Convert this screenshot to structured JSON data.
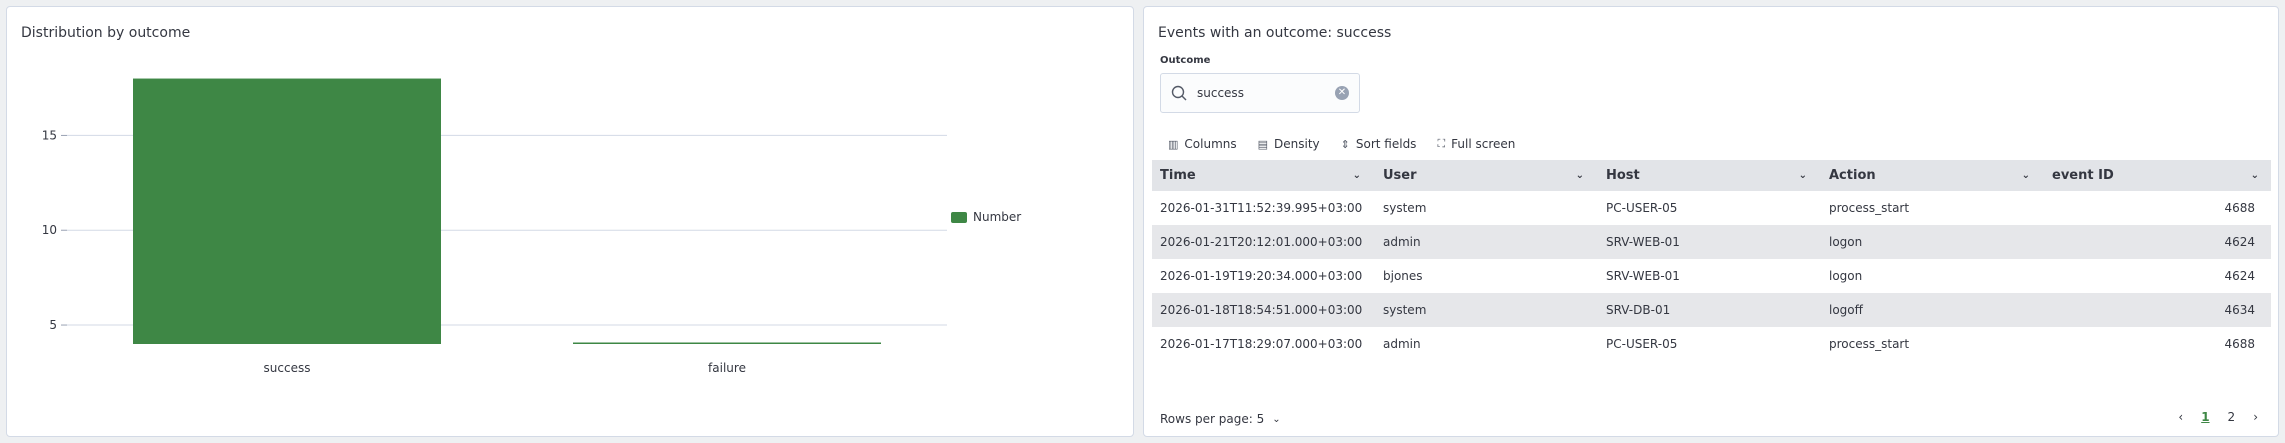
{
  "left_panel": {
    "title": "Distribution by outcome"
  },
  "chart_data": {
    "type": "bar",
    "categories": [
      "success",
      "failure"
    ],
    "series": [
      {
        "name": "Number",
        "values": [
          18,
          4
        ]
      }
    ],
    "yticks": [
      5,
      10,
      15
    ],
    "ylim": [
      4,
      19.4
    ],
    "xlabel": "",
    "ylabel": "",
    "grid": true,
    "legend_position": "right",
    "color": "#3e8745"
  },
  "right_panel": {
    "title": "Events with an outcome: success",
    "field_label": "Outcome",
    "search_value": "success",
    "toolbar": {
      "columns": "Columns",
      "density": "Density",
      "sort_fields": "Sort fields",
      "full_screen": "Full screen"
    },
    "headers": [
      "Time",
      "User",
      "Host",
      "Action",
      "event ID"
    ],
    "rows": [
      [
        "2026-01-31T11:52:39.995+03:00",
        "system",
        "PC-USER-05",
        "process_start",
        "4688"
      ],
      [
        "2026-01-21T20:12:01.000+03:00",
        "admin",
        "SRV-WEB-01",
        "logon",
        "4624"
      ],
      [
        "2026-01-19T19:20:34.000+03:00",
        "bjones",
        "SRV-WEB-01",
        "logon",
        "4624"
      ],
      [
        "2026-01-18T18:54:51.000+03:00",
        "system",
        "SRV-DB-01",
        "logoff",
        "4634"
      ],
      [
        "2026-01-17T18:29:07.000+03:00",
        "admin",
        "PC-USER-05",
        "process_start",
        "4688"
      ]
    ],
    "rows_per_page": "Rows per page: 5",
    "pages": [
      "1",
      "2"
    ],
    "active_page": "1"
  }
}
